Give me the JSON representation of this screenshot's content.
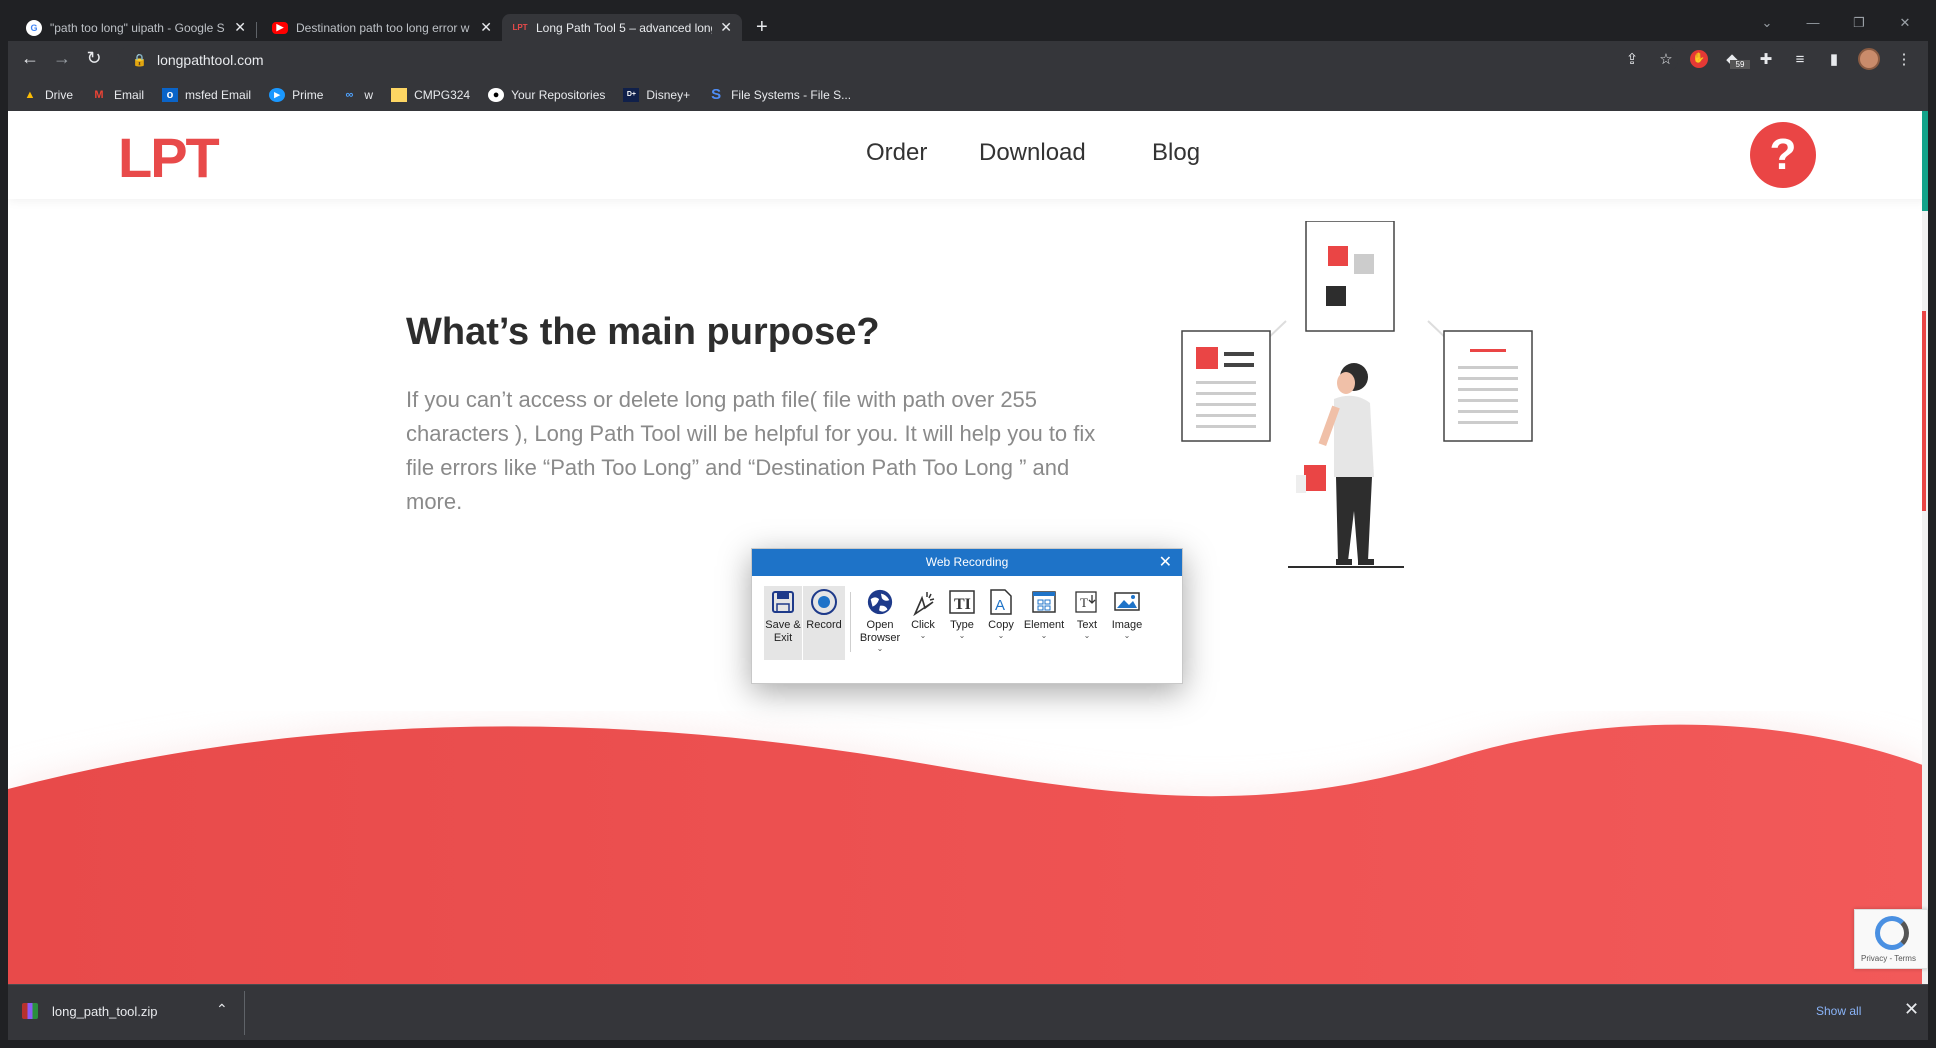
{
  "browser": {
    "tabs": [
      {
        "title": "\"path too long\" uipath - Google S",
        "favicon": "google-icon",
        "active": false
      },
      {
        "title": "Destination path too long error w",
        "favicon": "youtube-icon",
        "active": false
      },
      {
        "title": "Long Path Tool 5 – advanced long",
        "favicon": "lpt-icon",
        "active": true
      }
    ],
    "lpt_fav_text": "LPT",
    "newtab_label": "+",
    "address": "longpathtool.com",
    "bookmarks": [
      {
        "label": "Drive",
        "icon": "drive-icon"
      },
      {
        "label": "Email",
        "icon": "gmail-icon"
      },
      {
        "label": "msfed Email",
        "icon": "outlook-icon"
      },
      {
        "label": "Prime",
        "icon": "prime-icon"
      },
      {
        "label": "w",
        "icon": "infinity-icon"
      },
      {
        "label": "CMPG324",
        "icon": "folder-icon"
      },
      {
        "label": "Your Repositories",
        "icon": "github-icon"
      },
      {
        "label": "Disney+",
        "icon": "disney-icon"
      },
      {
        "label": "File Systems - File S...",
        "icon": "s-icon"
      }
    ],
    "ext_badge": "59"
  },
  "site": {
    "logo": "LPT",
    "nav": [
      "Order",
      "Download",
      "Blog"
    ],
    "help_label": "?",
    "heading": "What’s the main purpose?",
    "body": "If you can’t access or delete long path file( file with path over 255 characters ), Long Path Tool will be helpful for you. It will help you to fix file errors like “Path Too Long” and “Destination Path Too Long ” and more.",
    "recaptcha": "Privacy - Terms",
    "colors": {
      "brand": "#ea4545",
      "text": "#2d2d2d",
      "muted": "#8a8a8a"
    }
  },
  "recorder": {
    "title": "Web Recording",
    "tools": [
      {
        "label": "Save & Exit",
        "icon": "save-icon",
        "dropdown": false,
        "selected": true
      },
      {
        "label": "Record",
        "icon": "record-icon",
        "dropdown": false,
        "selected": true
      },
      {
        "label": "Open Browser",
        "icon": "globe-icon",
        "dropdown": true,
        "selected": false
      },
      {
        "label": "Click",
        "icon": "cursor-click-icon",
        "dropdown": true,
        "selected": false
      },
      {
        "label": "Type",
        "icon": "type-icon",
        "dropdown": true,
        "selected": false
      },
      {
        "label": "Copy",
        "icon": "copy-text-icon",
        "dropdown": true,
        "selected": false
      },
      {
        "label": "Element",
        "icon": "element-icon",
        "dropdown": true,
        "selected": false
      },
      {
        "label": "Text",
        "icon": "text-icon",
        "dropdown": true,
        "selected": false
      },
      {
        "label": "Image",
        "icon": "image-icon",
        "dropdown": true,
        "selected": false
      }
    ]
  },
  "downloads": {
    "file": "long_path_tool.zip",
    "show_all": "Show all"
  }
}
